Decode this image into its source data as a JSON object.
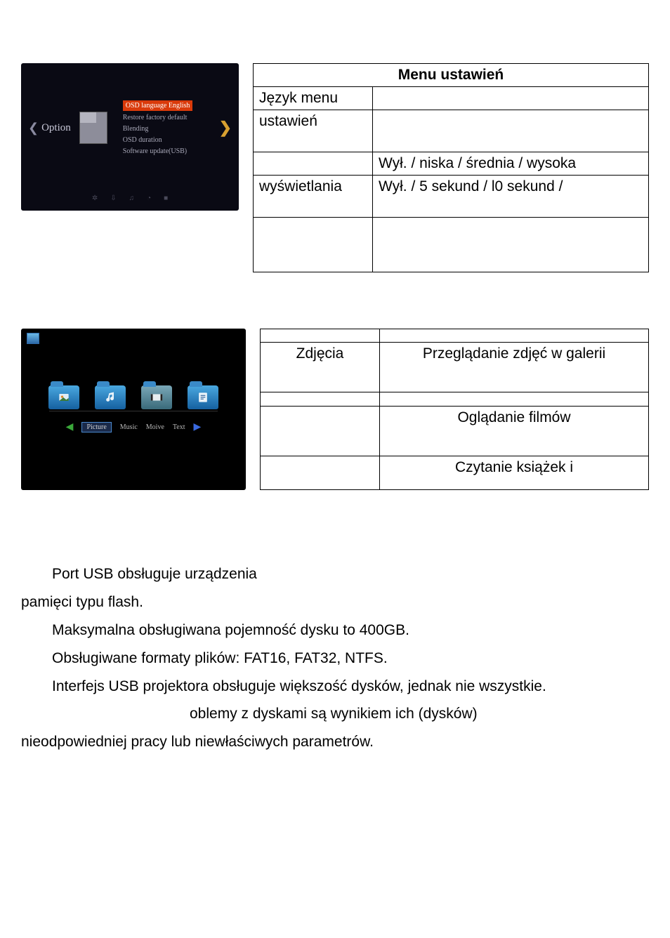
{
  "shot1": {
    "left_label": "Option",
    "items": [
      "OSD language English",
      "Restore factory default",
      "Blending",
      "OSD duration",
      "Software update(USB)"
    ]
  },
  "table1": {
    "title": "Menu ustawień",
    "rows": [
      {
        "c1": "Język menu",
        "c2": ""
      },
      {
        "c1": "ustawień",
        "c2": ""
      },
      {
        "c1": "",
        "c2": "Wył. / niska / średnia / wysoka"
      },
      {
        "c1": "wyświetlania",
        "c2": "Wył. / 5 sekund / l0 sekund /"
      },
      {
        "c1": "",
        "c2": ""
      }
    ]
  },
  "shot2": {
    "tabs": [
      "Picture",
      "Music",
      "Moive",
      "Text"
    ]
  },
  "table2": {
    "rows": [
      {
        "c1": "",
        "c2": ""
      },
      {
        "c1": "Zdjęcia",
        "c2": "Przeglądanie zdjęć w galerii"
      },
      {
        "c1": "",
        "c2": ""
      },
      {
        "c1": "",
        "c2": "Oglądanie filmów"
      },
      {
        "c1": "",
        "c2": "Czytanie książek i"
      }
    ]
  },
  "para": {
    "l1": "Port USB obsługuje urządzenia",
    "l2": "pamięci typu flash.",
    "l3": "Maksymalna obsługiwana pojemność dysku to 400GB.",
    "l4": "Obsługiwane formaty plików: FAT16, FAT32, NTFS.",
    "l5": "Interfejs USB projektora obsługuje większość dysków, jednak nie wszystkie.",
    "l6": "oblemy z dyskami są wynikiem ich (dysków)",
    "l7": "nieodpowiedniej pracy lub niewłaściwych parametrów."
  }
}
